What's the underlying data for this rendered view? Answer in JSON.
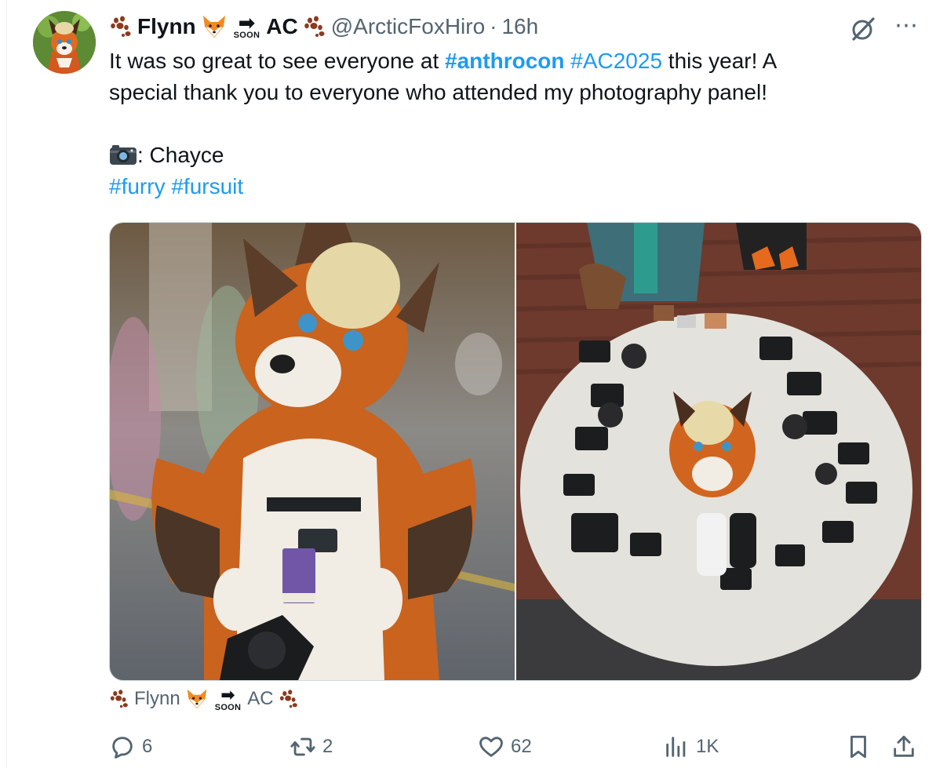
{
  "author": {
    "display_first": "Flynn",
    "soon_label": "SOON",
    "display_second": "AC",
    "handle": "@ArcticFoxHiro",
    "separator": "·",
    "time": "16h"
  },
  "tweet": {
    "line1_pre": "It was so great to see everyone at ",
    "hashtag_anthrocon": "#anthrocon",
    "hashtag_ac2025": "#AC2025",
    "line1_post": " this year! A",
    "line2": "special thank you to everyone who attended my photography panel!",
    "credit": ": Chayce",
    "hashtag_furry": "#furry",
    "hashtag_fursuit": "#fursuit"
  },
  "tagged_user": {
    "first": "Flynn",
    "soon_label": "SOON",
    "second": "AC"
  },
  "actions": {
    "replies": "6",
    "reposts": "2",
    "likes": "62",
    "views": "1K"
  },
  "icons": [
    "paw-icon",
    "fox-emoji-icon",
    "soon-arrow-icon",
    "camera-emoji-icon",
    "grok-icon",
    "more-icon",
    "reply-icon",
    "repost-icon",
    "like-icon",
    "views-icon",
    "bookmark-icon",
    "share-icon"
  ],
  "colors": {
    "link": "#1d9bf0",
    "muted": "#536471",
    "text": "#0f1419",
    "paw": "#8a3a1e",
    "fox": "#f08a24"
  }
}
